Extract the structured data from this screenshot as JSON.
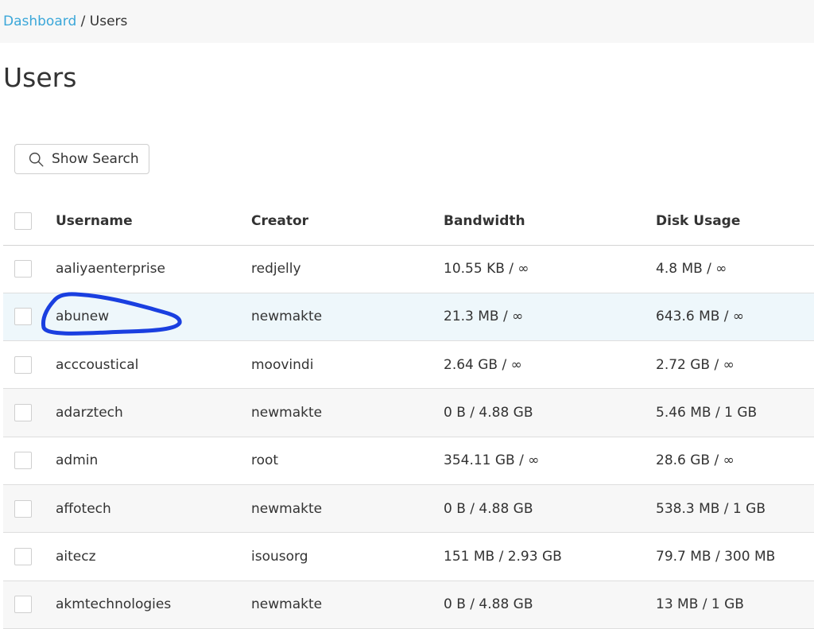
{
  "breadcrumb": {
    "parent": "Dashboard",
    "separator": " / ",
    "current": "Users"
  },
  "page_title": "Users",
  "search_button": {
    "label": "Show Search",
    "icon": "search-icon"
  },
  "table": {
    "columns": [
      "Username",
      "Creator",
      "Bandwidth",
      "Disk Usage"
    ],
    "rows": [
      {
        "username": "aaliyaenterprise",
        "creator": "redjelly",
        "bandwidth": "10.55 KB / ∞",
        "disk": "4.8 MB / ∞"
      },
      {
        "username": "abunew",
        "creator": "newmakte",
        "bandwidth": "21.3 MB / ∞",
        "disk": "643.6 MB / ∞"
      },
      {
        "username": "acccoustical",
        "creator": "moovindi",
        "bandwidth": "2.64 GB / ∞",
        "disk": "2.72 GB / ∞"
      },
      {
        "username": "adarztech",
        "creator": "newmakte",
        "bandwidth": "0 B / 4.88 GB",
        "disk": "5.46 MB / 1 GB"
      },
      {
        "username": "admin",
        "creator": "root",
        "bandwidth": "354.11 GB / ∞",
        "disk": "28.6 GB / ∞"
      },
      {
        "username": "affotech",
        "creator": "newmakte",
        "bandwidth": "0 B / 4.88 GB",
        "disk": "538.3 MB / 1 GB"
      },
      {
        "username": "aitecz",
        "creator": "isousorg",
        "bandwidth": "151 MB / 2.93 GB",
        "disk": "79.7 MB / 300 MB"
      },
      {
        "username": "akmtechnologies",
        "creator": "newmakte",
        "bandwidth": "0 B / 4.88 GB",
        "disk": "13 MB / 1 GB"
      }
    ]
  },
  "colors": {
    "link": "#3ba7d9",
    "annotation_stroke": "#1a3fe0",
    "row_alt": "#f7f7f7",
    "row_highlight": "#eef7fb"
  }
}
